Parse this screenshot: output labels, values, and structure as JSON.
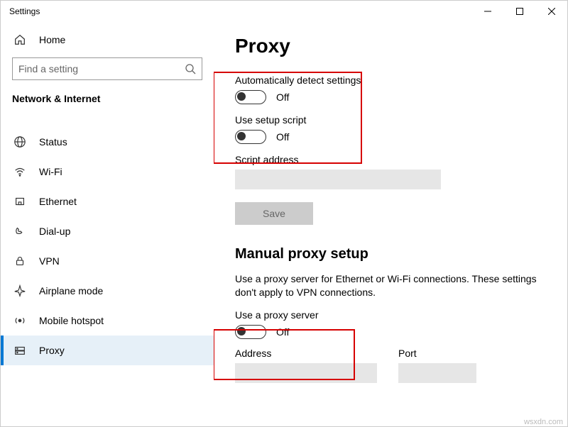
{
  "window": {
    "title": "Settings"
  },
  "sidebar": {
    "home": "Home",
    "search_placeholder": "Find a setting",
    "category": "Network & Internet",
    "items": [
      {
        "label": "Status"
      },
      {
        "label": "Wi-Fi"
      },
      {
        "label": "Ethernet"
      },
      {
        "label": "Dial-up"
      },
      {
        "label": "VPN"
      },
      {
        "label": "Airplane mode"
      },
      {
        "label": "Mobile hotspot"
      },
      {
        "label": "Proxy"
      }
    ]
  },
  "content": {
    "title": "Proxy",
    "auto_detect_label": "Automatically detect settings",
    "auto_detect_state": "Off",
    "setup_script_label": "Use setup script",
    "setup_script_state": "Off",
    "script_address_label": "Script address",
    "save_label": "Save",
    "manual_title": "Manual proxy setup",
    "manual_desc": "Use a proxy server for Ethernet or Wi-Fi connections. These settings don't apply to VPN connections.",
    "use_proxy_label": "Use a proxy server",
    "use_proxy_state": "Off",
    "address_label": "Address",
    "port_label": "Port"
  },
  "watermark": "wsxdn.com"
}
